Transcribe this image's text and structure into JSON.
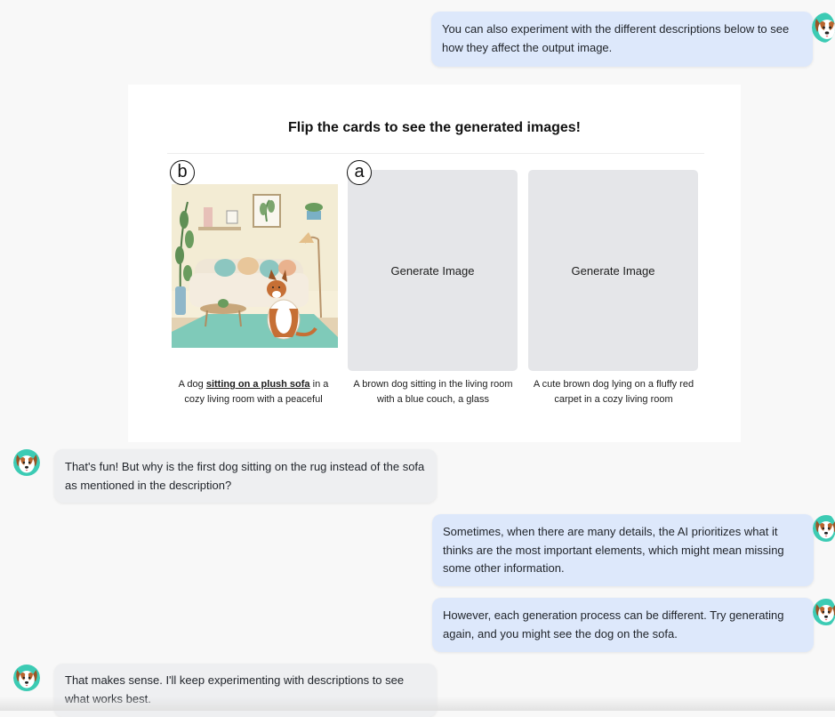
{
  "messages": {
    "m1": {
      "role": "user",
      "text": "You can also experiment with the different descriptions below to see how they affect the output image."
    },
    "m2": {
      "role": "bot",
      "text": "That's fun! But why is the first dog sitting on the rug instead of the sofa as mentioned in the description?"
    },
    "m3": {
      "role": "user",
      "text": "Sometimes, when there are many details, the AI prioritizes what it thinks are the most important elements, which might mean missing some other information."
    },
    "m4": {
      "role": "user",
      "text": "However, each generation process can be different. Try generating again, and you might see the dog on the sofa."
    },
    "m5": {
      "role": "bot",
      "text": "That makes sense. I'll keep experimenting with descriptions to see what works best."
    }
  },
  "panel": {
    "title": "Flip the cards to see the generated images!",
    "cards": [
      {
        "state": "generated",
        "caption_before": "A dog ",
        "caption_highlight": "sitting on a plush sofa",
        "caption_after": " in a cozy living room with a peaceful"
      },
      {
        "state": "empty",
        "button_label": "Generate Image",
        "caption": "A brown dog sitting in the living room with a blue couch, a glass"
      },
      {
        "state": "empty",
        "button_label": "Generate Image",
        "caption": "A cute brown dog lying on a fluffy red carpet in a cozy living room"
      }
    ]
  },
  "annotations": {
    "b": "b",
    "a": "a"
  },
  "colors": {
    "user_bubble": "#dde8fb",
    "bot_bubble": "#eeeff1",
    "avatar_bg": "#3ccbb4",
    "card_placeholder": "#e5e6e9"
  },
  "icons": {
    "avatar": "dog-face-avatar-icon",
    "generated_image": "living-room-dog-illustration"
  }
}
